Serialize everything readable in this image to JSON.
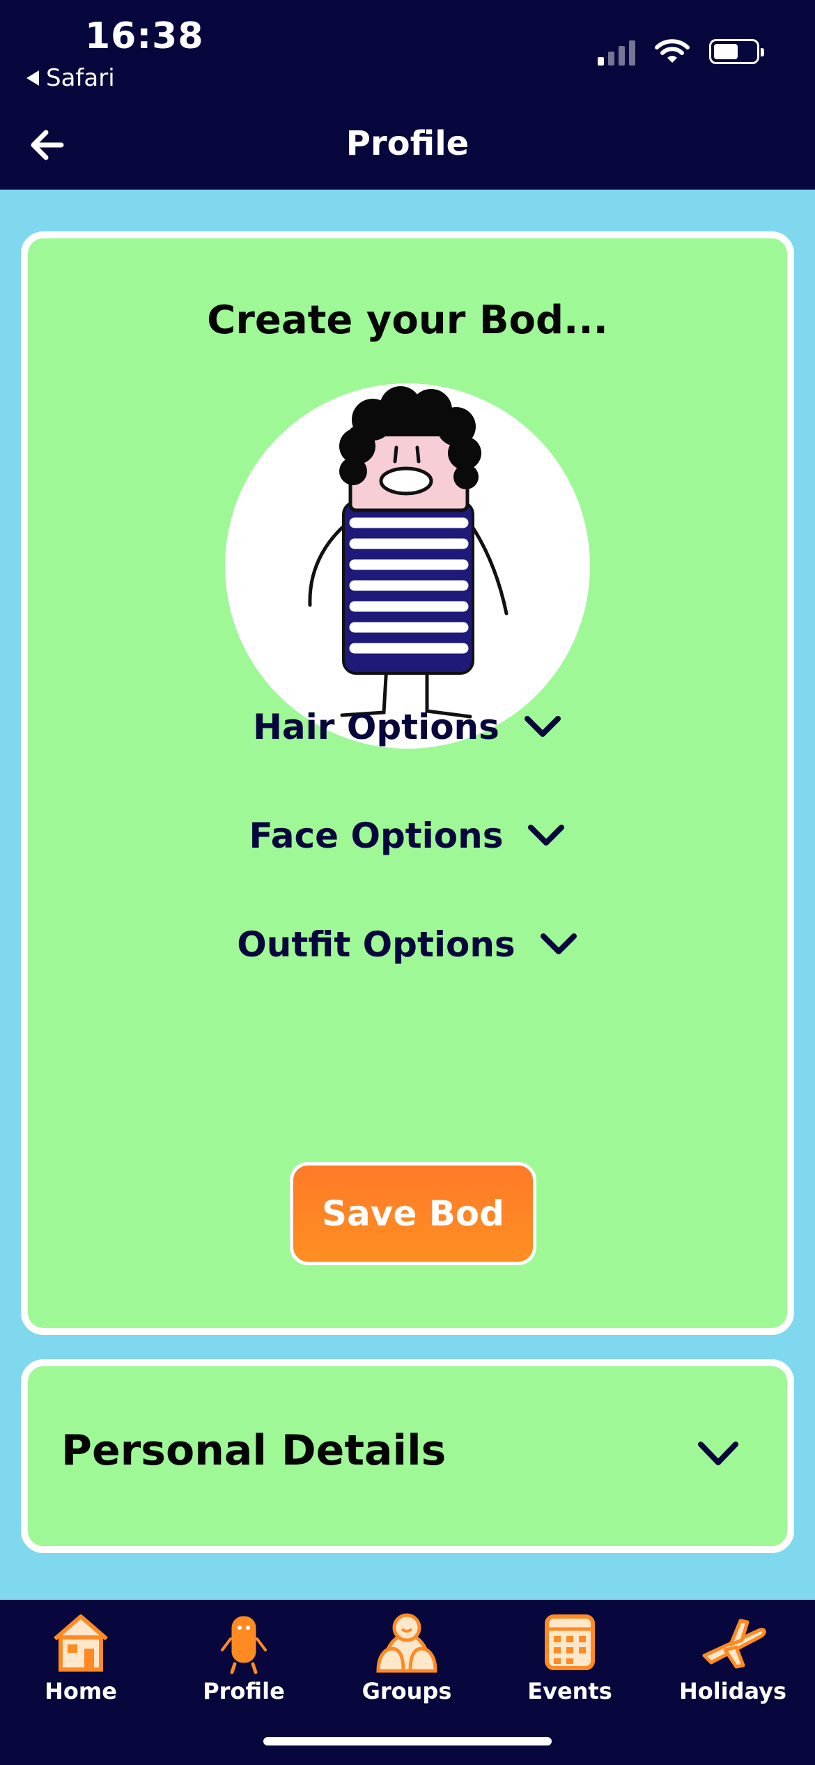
{
  "status_bar": {
    "time": "16:38",
    "back_app": "Safari"
  },
  "header": {
    "title": "Profile"
  },
  "bod_card": {
    "title": "Create your Bod...",
    "options": [
      {
        "label": "Hair Options"
      },
      {
        "label": "Face Options"
      },
      {
        "label": "Outfit Options"
      }
    ],
    "save_label": "Save Bod"
  },
  "personal_card": {
    "title": "Personal Details"
  },
  "tabs": [
    {
      "label": "Home",
      "icon": "house-icon"
    },
    {
      "label": "Profile",
      "icon": "bod-icon"
    },
    {
      "label": "Groups",
      "icon": "group-icon"
    },
    {
      "label": "Events",
      "icon": "calendar-icon"
    },
    {
      "label": "Holidays",
      "icon": "plane-icon"
    }
  ],
  "colors": {
    "header_bg": "#07063d",
    "page_bg": "#7fd8ee",
    "card_bg": "#9ef896",
    "accent_orange": "#ff8a22"
  }
}
